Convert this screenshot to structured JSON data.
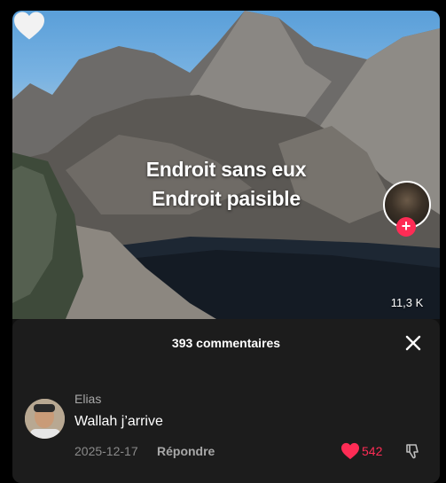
{
  "video": {
    "overlay_line1": "Endroit sans eux",
    "overlay_line2": "Endroit paisible",
    "follow_symbol": "+",
    "like_count": "11,3 K"
  },
  "comments": {
    "header": "393 commentaires",
    "close_symbol": "✕",
    "items": [
      {
        "username": "Elias",
        "text": "Wallah j’arrive",
        "date": "2025-12-17",
        "reply_label": "Répondre",
        "likes": "542",
        "liked": true
      }
    ]
  },
  "colors": {
    "accent_red": "#fe2c55",
    "sheet_bg": "#1c1c1c",
    "secondary_text": "#a8a8a8"
  },
  "icons": [
    "plus-icon",
    "heart-icon",
    "close-icon",
    "heart-filled-icon",
    "thumbs-down-icon"
  ]
}
